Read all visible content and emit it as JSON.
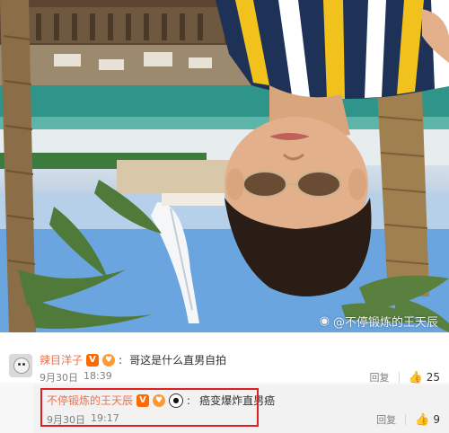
{
  "photo": {
    "watermark": "@不停锻炼的王天辰",
    "watermark_icon": "weibo-logo-icon"
  },
  "comment": {
    "username": "辣目洋子",
    "text": "哥这是什么直男自拍",
    "date": "9月30日",
    "time": "18:39",
    "reply_label": "回复",
    "like_count": "25",
    "badges": [
      "vip-v-icon",
      "fan-icon"
    ]
  },
  "reply": {
    "username": "不停锻炼的王天辰",
    "text": "癌变爆炸直男癌",
    "date": "9月30日",
    "time": "19:17",
    "reply_label": "回复",
    "like_count": "9",
    "badges": [
      "vip-v-icon",
      "fan-icon",
      "panda-icon"
    ]
  },
  "colors": {
    "username": "#eb7350",
    "highlight_border": "#e02020",
    "vip_badge": "#ff6a00"
  }
}
